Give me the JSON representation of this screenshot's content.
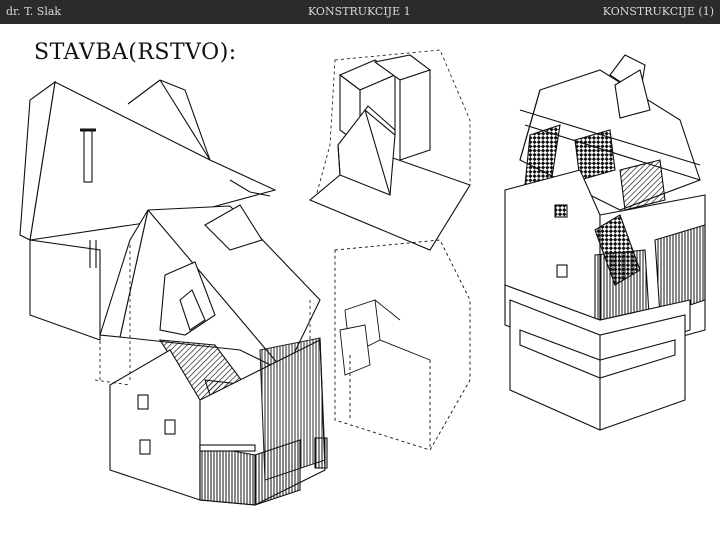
{
  "header": {
    "author": "dr. T. Slak",
    "center_title": "KONSTRUKCIJE 1",
    "right_title": "KONSTRUKCIJE (1)"
  },
  "slide": {
    "title": "STAVBA(RSTVO):"
  },
  "colors": {
    "top_bar": "#2b2b2b",
    "header_text": "#d8d8d8",
    "ink": "#111111",
    "background": "#ffffff"
  }
}
